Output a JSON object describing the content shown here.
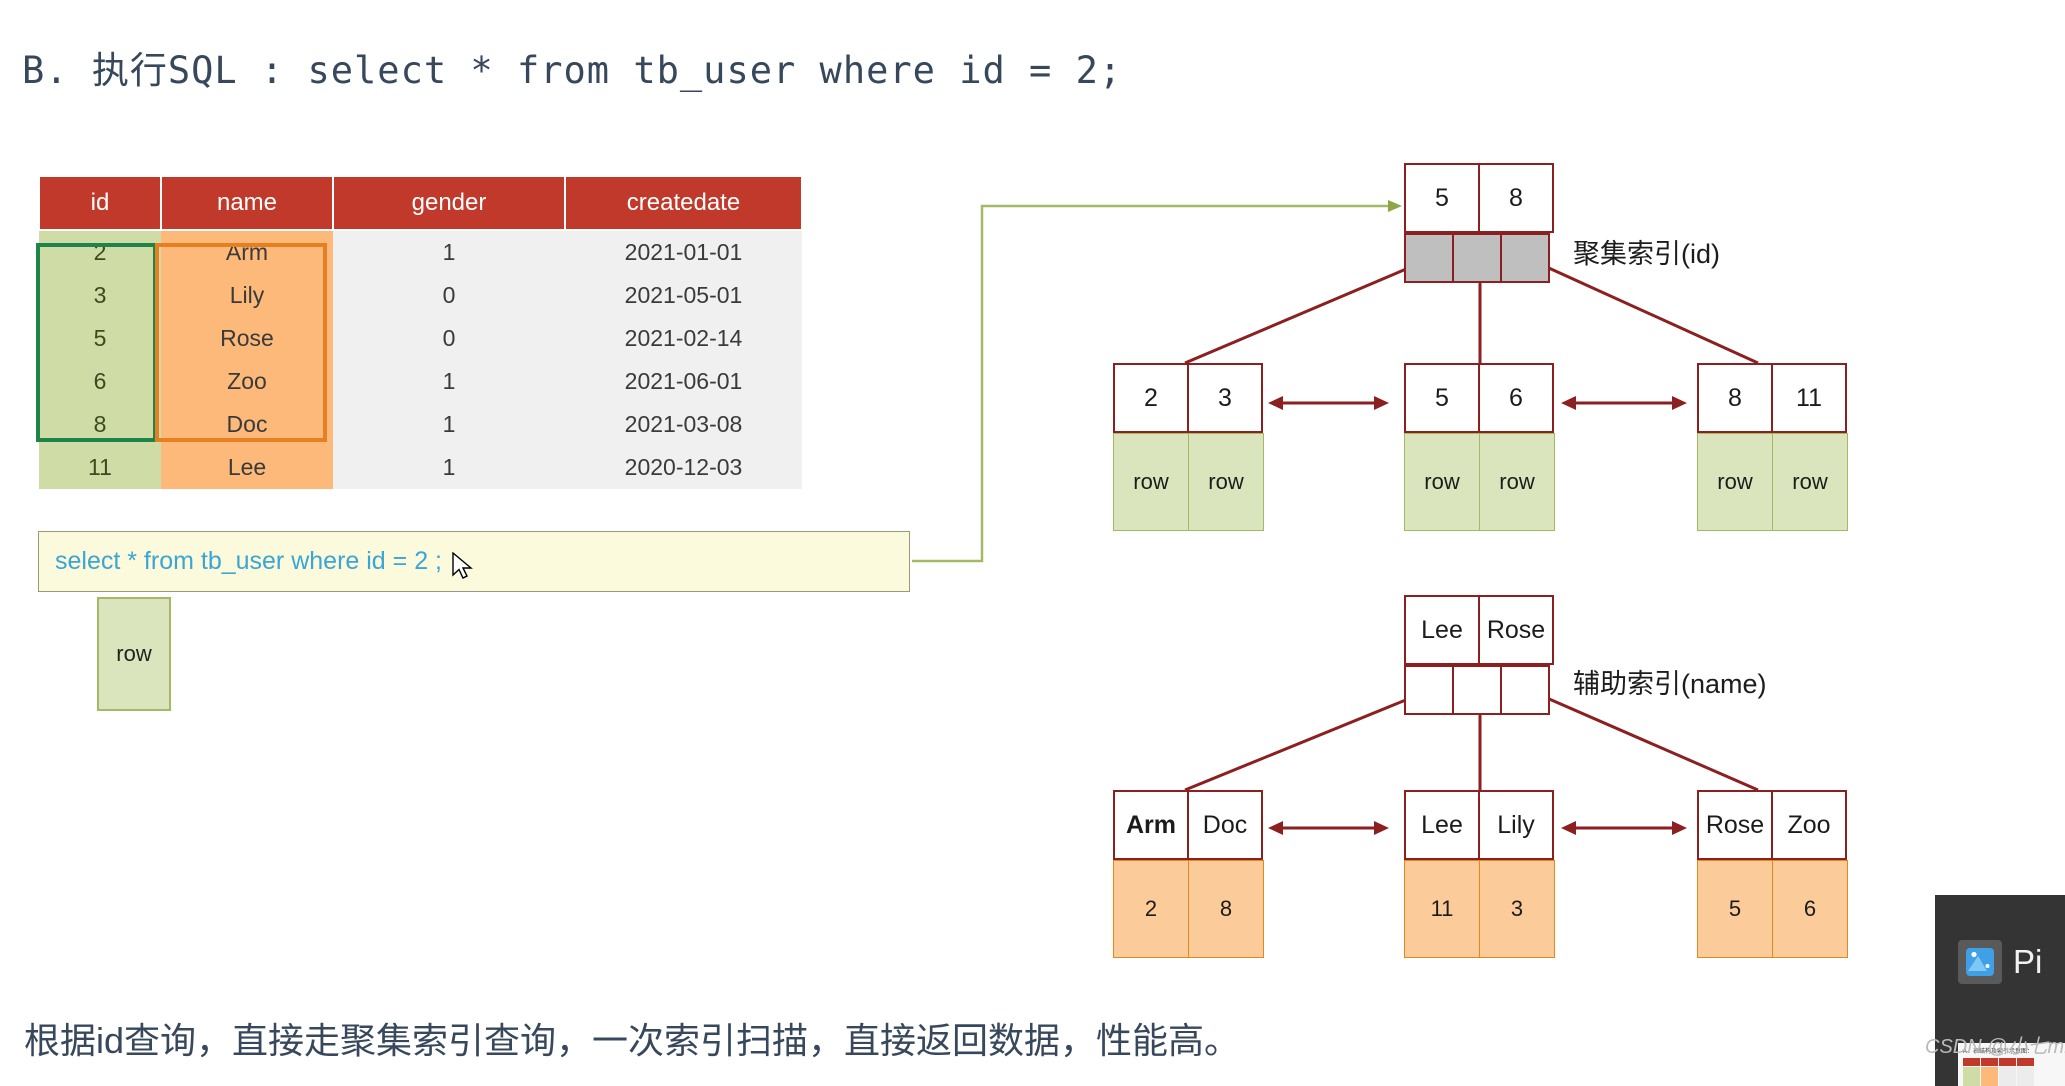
{
  "title": "B. 执行SQL : select * from tb_user where id = 2;",
  "table": {
    "headers": [
      "id",
      "name",
      "gender",
      "createdate"
    ],
    "rows": [
      {
        "id": "2",
        "name": "Arm",
        "gender": "1",
        "createdate": "2021-01-01"
      },
      {
        "id": "3",
        "name": "Lily",
        "gender": "0",
        "createdate": "2021-05-01"
      },
      {
        "id": "5",
        "name": "Rose",
        "gender": "0",
        "createdate": "2021-02-14"
      },
      {
        "id": "6",
        "name": "Zoo",
        "gender": "1",
        "createdate": "2021-06-01"
      },
      {
        "id": "8",
        "name": "Doc",
        "gender": "1",
        "createdate": "2021-03-08"
      },
      {
        "id": "11",
        "name": "Lee",
        "gender": "1",
        "createdate": "2020-12-03"
      }
    ],
    "highlight_id_color": "#1e8449",
    "highlight_name_color": "#e67e22",
    "header_color": "#c0392b"
  },
  "sql_callout": {
    "text": "select * from tb_user where id = 2 ;",
    "text_color": "#3ba5d4",
    "background": "#fbfadd"
  },
  "solo_row_box": {
    "label": "row"
  },
  "clustered_index": {
    "label": "聚集索引(id)",
    "root": {
      "keys": [
        "5",
        "8"
      ],
      "pointers": 3
    },
    "leaves": [
      {
        "keys": [
          "2",
          "3"
        ],
        "data": [
          "row",
          "row"
        ]
      },
      {
        "keys": [
          "5",
          "6"
        ],
        "data": [
          "row",
          "row"
        ]
      },
      {
        "keys": [
          "8",
          "11"
        ],
        "data": [
          "row",
          "row"
        ]
      }
    ]
  },
  "secondary_index": {
    "label": "辅助索引(name)",
    "root": {
      "keys": [
        "Lee",
        "Rose"
      ],
      "pointers": 3
    },
    "leaves": [
      {
        "keys": [
          "Arm",
          "Doc"
        ],
        "bold": [
          true,
          false
        ],
        "data": [
          "2",
          "8"
        ]
      },
      {
        "keys": [
          "Lee",
          "Lily"
        ],
        "bold": [
          false,
          false
        ],
        "data": [
          "11",
          "3"
        ]
      },
      {
        "keys": [
          "Rose",
          "Zoo"
        ],
        "bold": [
          false,
          false
        ],
        "data": [
          "5",
          "6"
        ]
      }
    ]
  },
  "caption": "根据id查询，直接走聚集索引查询，一次索引扫描，直接返回数据，性能高。",
  "overlay_panel": {
    "app_title": "Pi",
    "thumb_caption": "A、表结构及索引示意图："
  },
  "watermark": "CSDN @小七mm"
}
